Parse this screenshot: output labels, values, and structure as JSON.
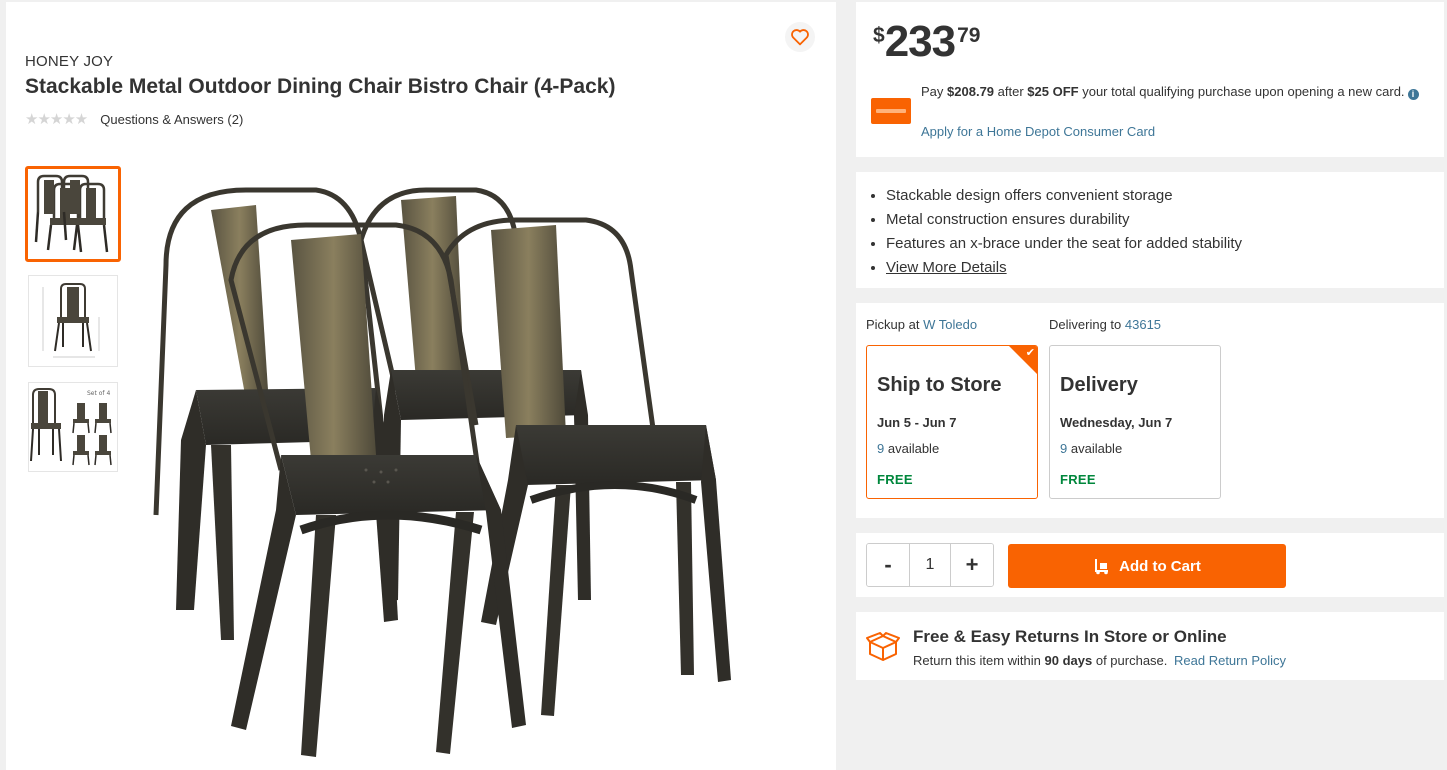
{
  "product": {
    "brand": "HONEY JOY",
    "title": "Stackable Metal Outdoor Dining Chair Bistro Chair (4-Pack)",
    "stars": "★★★★★",
    "rating": 0,
    "qa_link": "Questions & Answers (2)",
    "favorite_icon": "heart-icon"
  },
  "gallery": {
    "thumb3_label": "Set of 4"
  },
  "price": {
    "currency": "$",
    "dollars": "233",
    "cents": "79"
  },
  "promo": {
    "pay_prefix": "Pay",
    "pay_amount": "$208.79",
    "after": "after",
    "off_amount": "$25 OFF",
    "suffix": "your total qualifying purchase upon opening a new card.",
    "info_icon": "i",
    "apply_link": "Apply for a Home Depot Consumer Card"
  },
  "highlights": [
    "Stackable design offers convenient storage",
    "Metal construction ensures durability",
    "Features an x-brace under the seat for added stability"
  ],
  "view_more": "View More Details",
  "fulfillment": {
    "pickup_label": "Pickup at",
    "pickup_store": "W Toledo",
    "delivery_label": "Delivering to",
    "delivery_zip": "43615",
    "options": [
      {
        "title": "Ship to Store",
        "date": "Jun 5 - Jun 7",
        "count": "9",
        "avail": "available",
        "price": "FREE",
        "selected": true
      },
      {
        "title": "Delivery",
        "date": "Wednesday, Jun 7",
        "count": "9",
        "avail": "available",
        "price": "FREE",
        "selected": false
      }
    ]
  },
  "cart": {
    "minus": "-",
    "quantity": "1",
    "plus": "+",
    "add_label": "Add to Cart"
  },
  "returns": {
    "title": "Free & Easy Returns In Store or Online",
    "desc_prefix": "Return this item within",
    "days": "90 days",
    "desc_suffix": "of purchase.",
    "link": "Read Return Policy"
  },
  "colors": {
    "accent": "#f96302",
    "link": "#3e7697",
    "free": "#00873c"
  }
}
